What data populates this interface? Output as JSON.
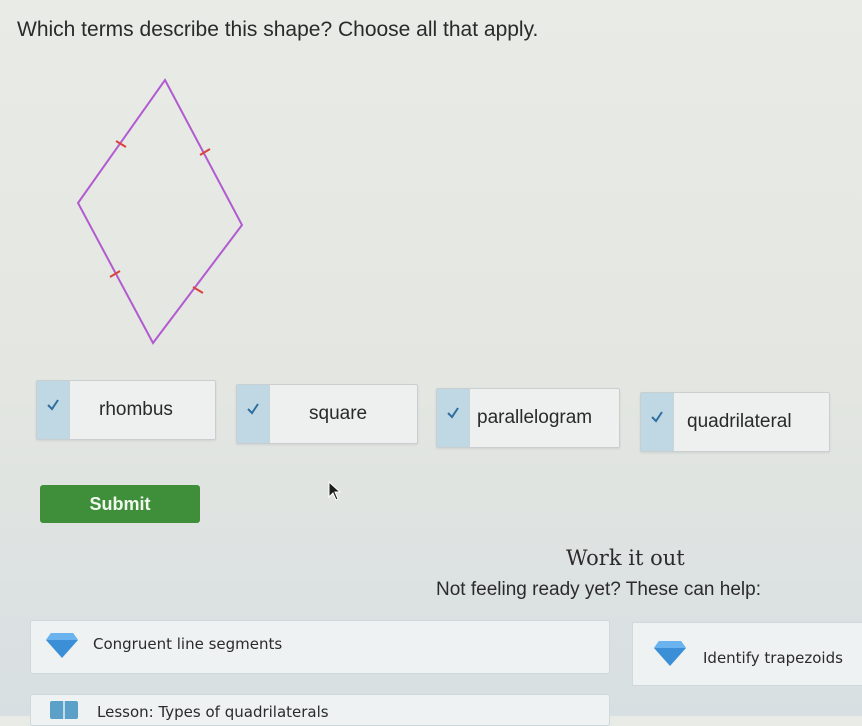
{
  "question": "Which terms describe this shape? Choose all that apply.",
  "choices": [
    {
      "label": "rhombus",
      "checked": true
    },
    {
      "label": "square",
      "checked": true
    },
    {
      "label": "parallelogram",
      "checked": true
    },
    {
      "label": "quadrilateral",
      "checked": true
    }
  ],
  "submit_label": "Submit",
  "work": {
    "title": "Work it out",
    "subtitle": "Not feeling ready yet? These can help:"
  },
  "help_links": [
    {
      "label": "Congruent line segments",
      "icon": "diamond-gem-icon"
    },
    {
      "label": "Identify trapezoids",
      "icon": "diamond-gem-icon"
    },
    {
      "label": "Lesson: Types of quadrilaterals",
      "icon": "lesson-book-icon"
    }
  ],
  "colors": {
    "shape_stroke": "#b25bd0",
    "tick_marks": "#d9443b",
    "check_box": "#bfd8e4",
    "check_mark": "#2f6fa0",
    "submit_bg": "#3f8f3a",
    "gem": "#3a8fd6"
  }
}
